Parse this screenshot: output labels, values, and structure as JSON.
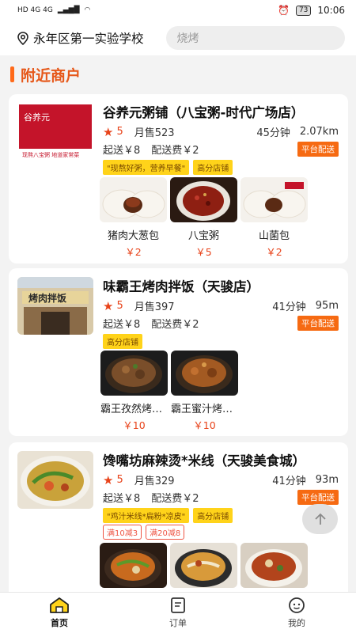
{
  "status": {
    "left": "HD 4G 4G",
    "battery": "73",
    "time": "10:06"
  },
  "header": {
    "location": "永年区第一实验学校",
    "search_placeholder": "烧烤"
  },
  "section": {
    "title": "附近商户"
  },
  "colors": {
    "accent": "#e8431a",
    "platform_badge": "#f66a12",
    "tag_yellow": "#ffd31a"
  },
  "shops": [
    {
      "name": "谷养元粥铺（八宝粥-时代广场店）",
      "rating": "5",
      "sales": "月售523",
      "time": "45分钟",
      "distance": "2.07km",
      "min_order": "起送￥8",
      "delivery_fee": "配送费￥2",
      "badge": "平台配送",
      "tags": [
        "\"现熬好粥，营养早餐\"",
        "高分店铺"
      ],
      "items": [
        {
          "name": "猪肉大葱包",
          "price": "￥2"
        },
        {
          "name": "八宝粥",
          "price": "￥5"
        },
        {
          "name": "山菌包",
          "price": "￥2"
        }
      ]
    },
    {
      "name": "味霸王烤肉拌饭（天骏店）",
      "rating": "5",
      "sales": "月售397",
      "time": "41分钟",
      "distance": "95m",
      "min_order": "起送￥8",
      "delivery_fee": "配送费￥2",
      "badge": "平台配送",
      "tags": [
        "高分店铺"
      ],
      "items": [
        {
          "name": "霸王孜然烤肉饭",
          "price": "￥10"
        },
        {
          "name": "霸王蜜汁烤肉饭",
          "price": "￥10"
        }
      ]
    },
    {
      "name": "馋嘴坊麻辣烫*米线（天骏美食城）",
      "rating": "5",
      "sales": "月售329",
      "time": "41分钟",
      "distance": "93m",
      "min_order": "起送￥8",
      "delivery_fee": "配送费￥2",
      "badge": "平台配送",
      "tags": [
        "\"鸡汁米线*扁粉*凉皮\"",
        "高分店铺"
      ],
      "promos": [
        "满10减3",
        "满20减8"
      ]
    }
  ],
  "tabs": [
    {
      "label": "首页",
      "icon": "home-icon"
    },
    {
      "label": "订单",
      "icon": "order-icon"
    },
    {
      "label": "我的",
      "icon": "profile-icon"
    }
  ]
}
